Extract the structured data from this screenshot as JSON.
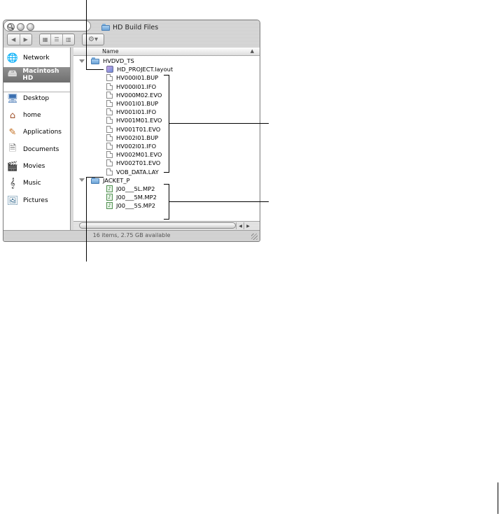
{
  "window": {
    "title": "HD Build Files",
    "search_placeholder": "",
    "status": "16 items, 2.75 GB available"
  },
  "toolbar": {
    "back_icon": "back-arrow-icon",
    "forward_icon": "forward-arrow-icon",
    "view_icons": [
      "icon-view-icon",
      "list-view-icon",
      "column-view-icon"
    ],
    "action_icon": "gear-icon"
  },
  "sidebar": {
    "items": [
      {
        "label": "Network",
        "icon": "globe-icon"
      },
      {
        "label": "Macintosh HD",
        "icon": "hard-disk-icon",
        "selected": true
      },
      {
        "label": "Desktop",
        "icon": "desktop-icon"
      },
      {
        "label": "home",
        "icon": "home-icon"
      },
      {
        "label": "Applications",
        "icon": "applications-icon"
      },
      {
        "label": "Documents",
        "icon": "documents-icon"
      },
      {
        "label": "Movies",
        "icon": "movies-icon"
      },
      {
        "label": "Music",
        "icon": "music-icon"
      },
      {
        "label": "Pictures",
        "icon": "pictures-icon"
      }
    ]
  },
  "list": {
    "column_header": "Name",
    "rows": [
      {
        "name": "HVDVD_TS",
        "kind": "folder",
        "level": 0
      },
      {
        "name": "HD_PROJECT.layout",
        "kind": "layout",
        "level": 1
      },
      {
        "name": "HV000I01.BUP",
        "kind": "file",
        "level": 1
      },
      {
        "name": "HV000I01.IFO",
        "kind": "file",
        "level": 1
      },
      {
        "name": "HV000M02.EVO",
        "kind": "file",
        "level": 1
      },
      {
        "name": "HV001I01.BUP",
        "kind": "file",
        "level": 1
      },
      {
        "name": "HV001I01.IFO",
        "kind": "file",
        "level": 1
      },
      {
        "name": "HV001M01.EVO",
        "kind": "file",
        "level": 1
      },
      {
        "name": "HV001T01.EVO",
        "kind": "file",
        "level": 1
      },
      {
        "name": "HV002I01.BUP",
        "kind": "file",
        "level": 1
      },
      {
        "name": "HV002I01.IFO",
        "kind": "file",
        "level": 1
      },
      {
        "name": "HV002M01.EVO",
        "kind": "file",
        "level": 1
      },
      {
        "name": "HV002T01.EVO",
        "kind": "file",
        "level": 1
      },
      {
        "name": "VOB_DATA.LAY",
        "kind": "file",
        "level": 1
      },
      {
        "name": "JACKET_P",
        "kind": "folder",
        "level": 0
      },
      {
        "name": "J00___5L.MP2",
        "kind": "mp2",
        "level": 1
      },
      {
        "name": "J00___5M.MP2",
        "kind": "mp2",
        "level": 1
      },
      {
        "name": "J00___5S.MP2",
        "kind": "mp2",
        "level": 1
      }
    ]
  }
}
